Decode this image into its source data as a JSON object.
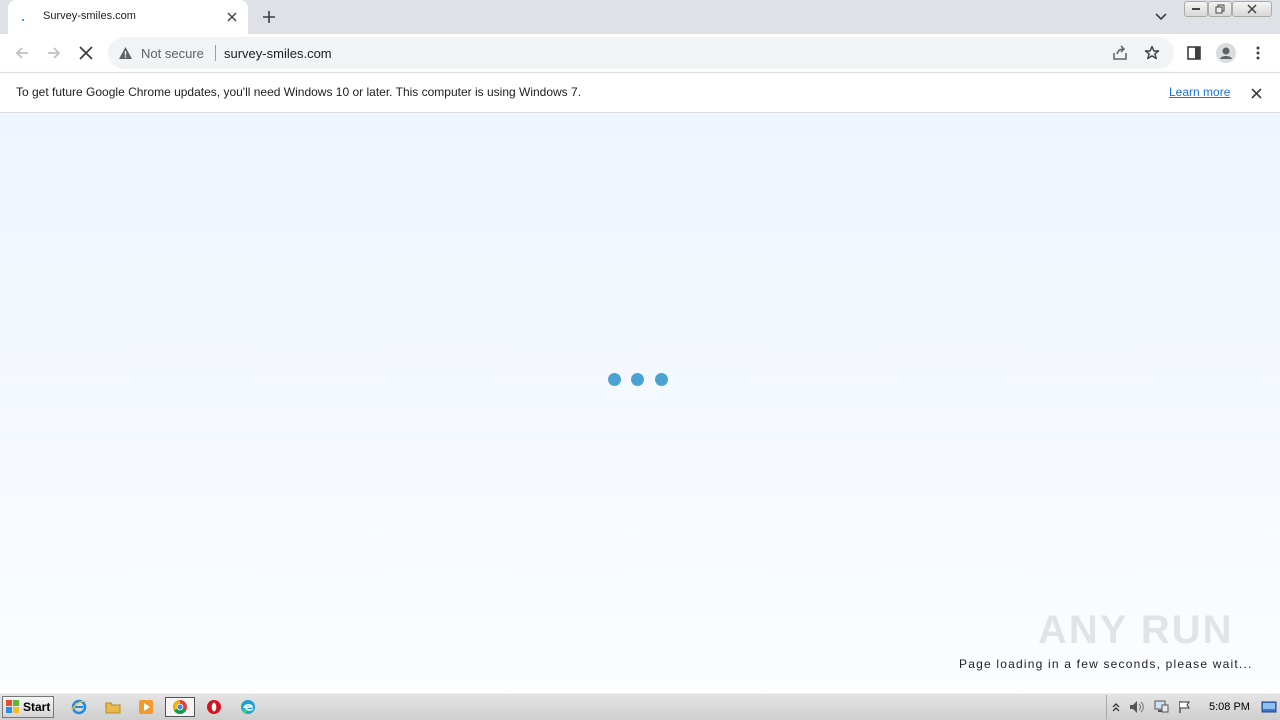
{
  "tab": {
    "title": "Survey-smiles.com"
  },
  "omnibox": {
    "security_label": "Not secure",
    "url": "survey-smiles.com"
  },
  "infobar": {
    "message": "To get future Google Chrome updates, you'll need Windows 10 or later. This computer is using Windows 7.",
    "link_label": "Learn more"
  },
  "page": {
    "loading_message": "Page loading in a few seconds, please wait...",
    "watermark": "ANY RUN",
    "dot_color": "#4ba3d3"
  },
  "taskbar": {
    "start_label": "Start",
    "clock": "5:08 PM",
    "apps": [
      "internet-explorer-icon",
      "file-explorer-icon",
      "media-player-icon",
      "chrome-icon",
      "opera-icon",
      "edge-icon"
    ]
  },
  "colors": {
    "accent": "#1a73e8",
    "tabstrip": "#dee1e6",
    "omnibox": "#f1f3f4"
  }
}
